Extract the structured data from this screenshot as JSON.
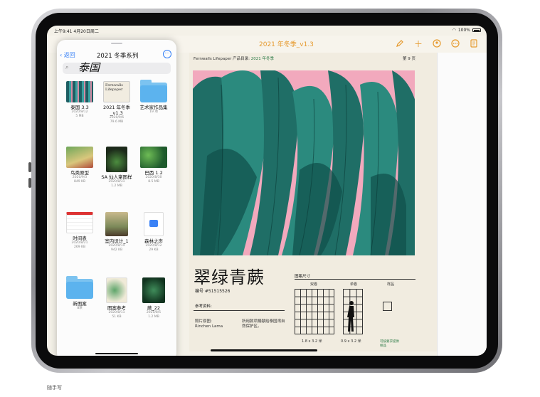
{
  "status": {
    "time": "上午9:41  4月20日周二",
    "battery": "100%"
  },
  "toolbar": {
    "title": "2021 年冬季_v1.3"
  },
  "files": {
    "back": "返回",
    "title": "2021 冬季系列",
    "search_text": "泰国",
    "items": [
      {
        "name": "泰国 3.3",
        "date": "2020/9/12",
        "size": "5 MB"
      },
      {
        "name": "2021 年冬季_v1.3",
        "date": "2020/9/6",
        "size": "79.6 MB"
      },
      {
        "name": "艺术家作品集",
        "date": "19 项",
        "size": ""
      },
      {
        "name": "鸟类原型",
        "date": "2020/9/3",
        "size": "849 KB"
      },
      {
        "name": "SA 仙人掌图样",
        "date": "2020/8/31",
        "size": "1.2 MB"
      },
      {
        "name": "巴西 1.2",
        "date": "2020/8/30",
        "size": "8.5 MB"
      },
      {
        "name": "时间表",
        "date": "2020/8/21",
        "size": "269 KB"
      },
      {
        "name": "室内设计_1",
        "date": "2020/8/14",
        "size": "942 KB"
      },
      {
        "name": "森林之声",
        "date": "2020/8/12",
        "size": "29 KB"
      },
      {
        "name": "新图案",
        "date": "8项",
        "size": ""
      },
      {
        "name": "图案参考",
        "date": "2020/8/11",
        "size": "51 KB"
      },
      {
        "name": "蕨_22",
        "date": "2020/8/5",
        "size": "1.2 MB"
      }
    ]
  },
  "document": {
    "header": "Fernwalls Lifepaper 产品目录:",
    "header_highlight": "2021 年冬季",
    "page": "第 9 页",
    "title": "翠绿青蕨",
    "code": "编号 #51515526",
    "ref_label": "参考资料:",
    "photo_label": "照片原图:",
    "photo_name": "Rinchen Lama",
    "photo_desc": "所用款项捐献给泰国湾自然保护区。",
    "size_label": "图案尺寸",
    "double": "双卷",
    "single": "单卷",
    "sample": "样品",
    "dim_double": "1.8 x 3.2 米",
    "dim_single": "0.9 x 3.2 米",
    "note": "可按要求提供样品"
  },
  "caption": "随手写"
}
